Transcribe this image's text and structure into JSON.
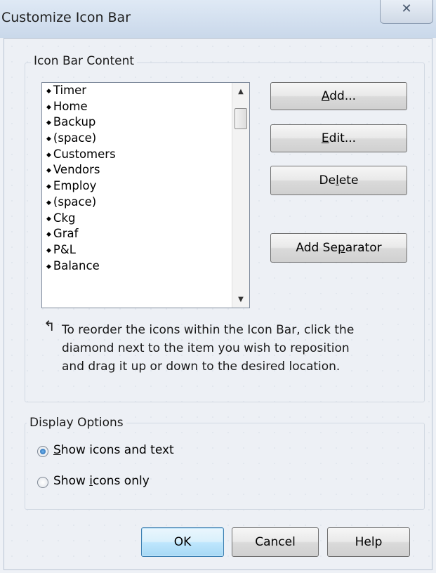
{
  "window": {
    "title": "Customize Icon Bar",
    "close_glyph": "✕"
  },
  "content_group": {
    "legend": "Icon Bar Content",
    "items": [
      "Timer",
      "Home",
      "Backup",
      "(space)",
      "Customers",
      "Vendors",
      "Employ",
      "(space)",
      "Ckg",
      "Graf",
      "P&L",
      "Balance"
    ],
    "buttons": {
      "add": {
        "pre": "",
        "key": "A",
        "post": "dd..."
      },
      "edit": {
        "pre": "",
        "key": "E",
        "post": "dit..."
      },
      "delete": {
        "pre": "De",
        "key": "l",
        "post": "ete"
      },
      "add_separator": {
        "pre": "Add Se",
        "key": "p",
        "post": "arator"
      }
    },
    "hint_lines": [
      "To reorder the icons within the Icon Bar, click the",
      "diamond next to the item you wish to reposition",
      "and drag it up or down to the desired location."
    ]
  },
  "display_group": {
    "legend": "Display Options",
    "options": [
      {
        "key": "S",
        "rest": "how icons and text",
        "pre": "",
        "checked": true
      },
      {
        "pre": "Show ",
        "key": "i",
        "rest": "cons only",
        "checked": false
      }
    ]
  },
  "footer": {
    "ok": "OK",
    "cancel": "Cancel",
    "help": "Help"
  },
  "colors": {
    "ok_border": "#3c7fb1",
    "radio_fill": "#1d5fa7"
  },
  "icons": {
    "list_bullet": "diamond-icon",
    "hint": "reorder-arrow-icon"
  }
}
